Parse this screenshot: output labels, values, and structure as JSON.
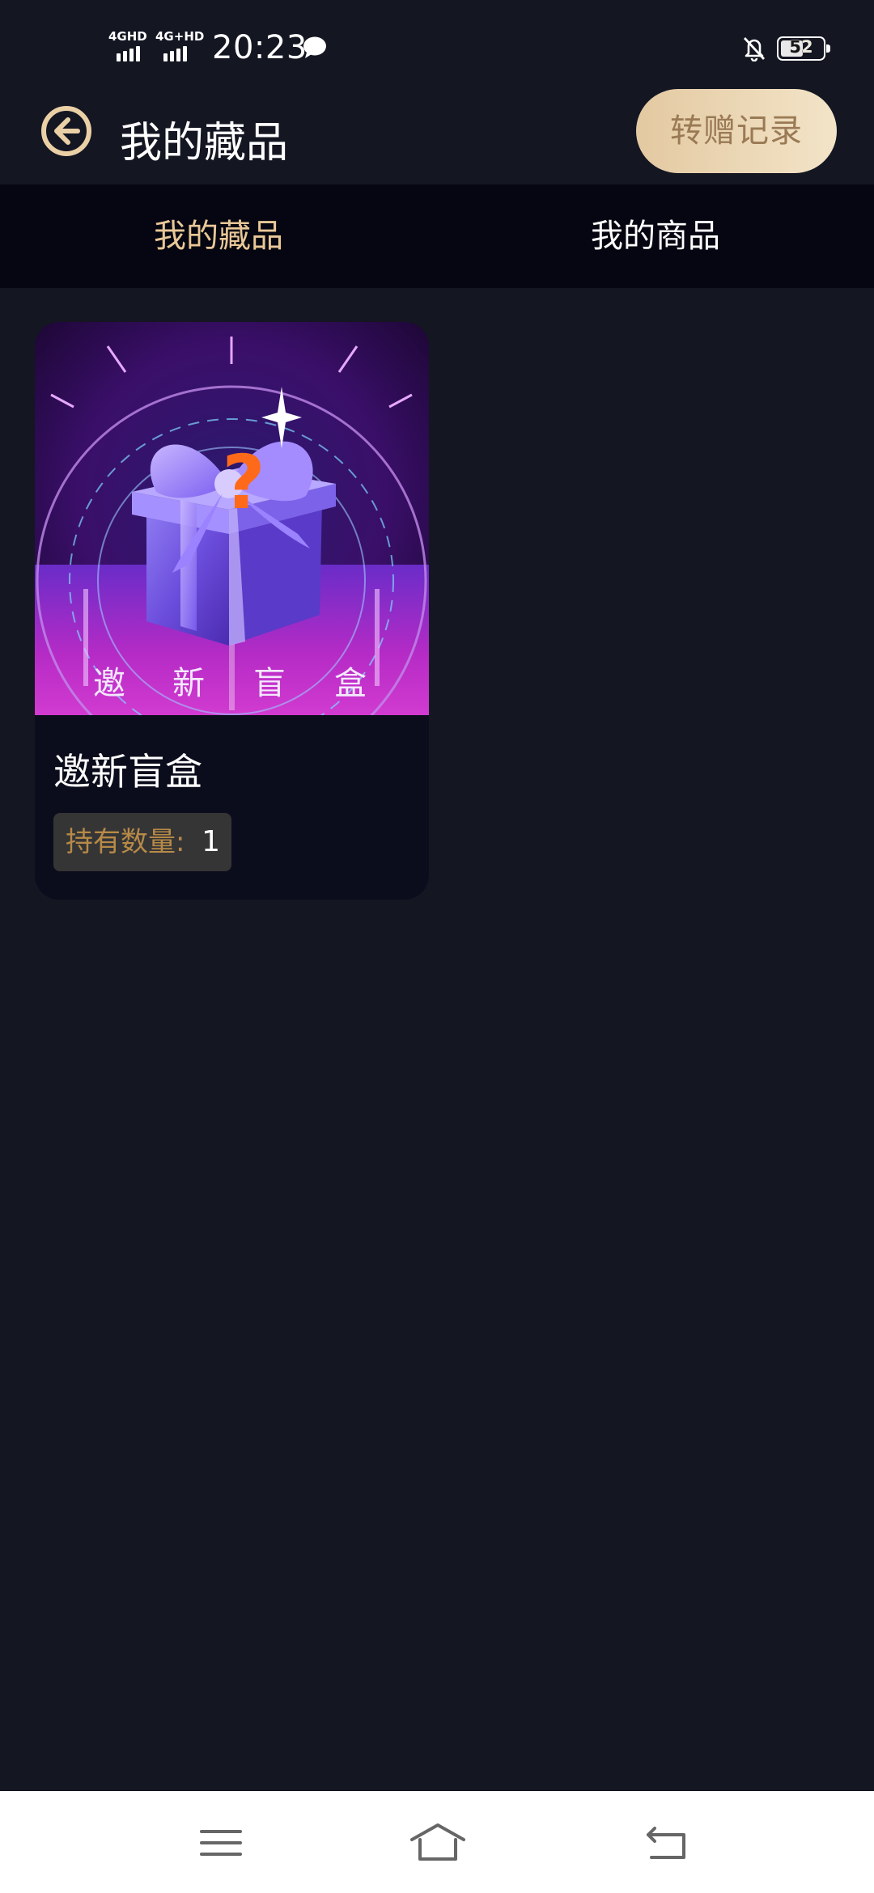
{
  "status_bar": {
    "signal1_label": "4GHD",
    "signal2_label": "4G+HD",
    "time": "20:23",
    "battery": "52",
    "icons": [
      "message-icon",
      "bell-off-icon",
      "battery-icon"
    ]
  },
  "header": {
    "title": "我的藏品",
    "transfer_button": "转赠记录"
  },
  "tabs": [
    {
      "label": "我的藏品",
      "active": true
    },
    {
      "label": "我的商品",
      "active": false
    }
  ],
  "items": [
    {
      "name": "邀新盲盒",
      "image_caption": [
        "邀",
        "新",
        "盲",
        "盒"
      ],
      "quantity_label": "持有数量:",
      "quantity": "1"
    }
  ],
  "colors": {
    "background": "#141622",
    "tab_bar": "#050611",
    "active_tab": "#e9c797",
    "accent_gold": "#b78a47",
    "transfer_button": "#e3c9a1"
  }
}
